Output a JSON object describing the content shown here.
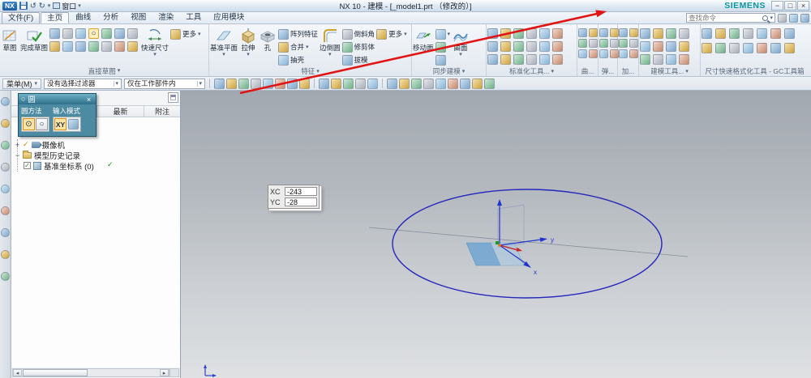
{
  "titlebar": {
    "logo": "NX",
    "title": "NX 10 - 建模 - [_model1.prt （修改的）]",
    "window_menu": "窗口",
    "brand": "SIEMENS"
  },
  "icons": {
    "dropdown": "▾",
    "close": "×",
    "minimize": "−",
    "maximize": "□",
    "check": "✓",
    "circle": "○",
    "circle_center": "⊙",
    "undo": "↺",
    "redo": "↻",
    "scroll_left": "◂",
    "scroll_right": "▸",
    "expand": "+",
    "collapse": "−"
  },
  "tabs": {
    "file": "文件(F)",
    "items": [
      "主页",
      "曲线",
      "分析",
      "视图",
      "渲染",
      "工具",
      "应用模块"
    ],
    "search_placeholder": "查找命令"
  },
  "ribbon": {
    "buttons": {
      "sketch": "草图",
      "finish_sketch": "完成草图",
      "quick_dim": "快速尺寸",
      "more": "更多",
      "datum_plane": "基准平面",
      "extrude": "拉伸",
      "hole": "孔",
      "pattern_feature": "阵列特征",
      "unite": "合并",
      "shell": "抽壳",
      "edge_blend": "边倒圆",
      "chamfer": "倒斜角",
      "trim_body": "修剪体",
      "draft": "拔模",
      "move_face": "移动面",
      "surface": "曲面"
    },
    "group_labels": [
      "直接草图",
      "特征",
      "同步建模",
      "标准化工具...",
      "曲...",
      "弹...",
      "加...",
      "建模工具...",
      "尺寸快速格式化工具 - GC工具箱"
    ]
  },
  "menubar": {
    "menu": "菜单(M)",
    "selection_filter": "没有选择过滤器",
    "scope_filter": "仅在工作部件内"
  },
  "dialog": {
    "title": "圆",
    "method_label": "圆方法",
    "input_mode_label": "输入模式",
    "xy": "XY"
  },
  "navigator": {
    "columns": [
      "最新",
      "附注"
    ],
    "items": [
      {
        "label": "摄像机"
      },
      {
        "label": "模型历史记录"
      },
      {
        "label": "基准坐标系 (0)"
      }
    ]
  },
  "canvas": {
    "coord": {
      "x_label": "XC",
      "x_value": "-243",
      "y_label": "YC",
      "y_value": "-28"
    },
    "axis_labels": {
      "x": "x",
      "y": "y"
    }
  }
}
